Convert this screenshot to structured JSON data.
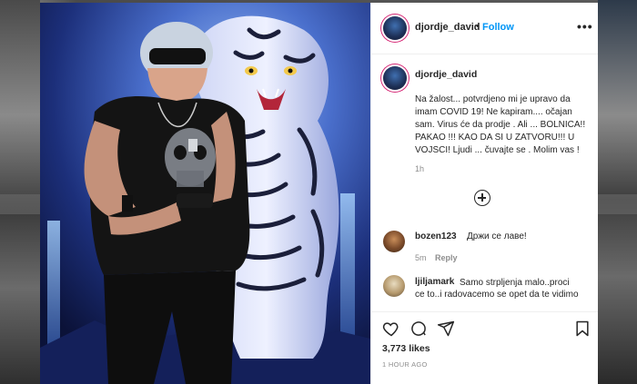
{
  "post": {
    "username": "djordje_david",
    "follow_label": "Follow",
    "separator": "•",
    "more_label": "•••",
    "caption_username": "djordje_david",
    "caption": "Na žalost... potvrdjeno mi je upravo da imam COVID 19! Ne kapiram.... očajan sam. Virus će da prodje . Ali ... BOLNICA!! PAKAO !!! KAO DA SI U ZATVORU!!! U VOJSCI! Ljudi ... čuvajte se . Molim vas !",
    "caption_time": "1h",
    "likes": "3,773 likes",
    "posted_ago": "1 HOUR AGO"
  },
  "comments": [
    {
      "username": "bozen123",
      "text": "Држи се лаве!",
      "time": "5m",
      "reply_label": "Reply"
    },
    {
      "username": "ljiljamark",
      "text": "Samo strpljenja malo..proci ce to..i radovacemo se opet da te vidimo"
    }
  ],
  "icons": {
    "like": "heart-icon",
    "comment": "comment-icon",
    "share": "share-icon",
    "save": "bookmark-icon",
    "load_more": "plus-circle-icon"
  },
  "colors": {
    "follow": "#0095f6",
    "text": "#262626",
    "muted": "#8e8e8e",
    "story_ring": "#d62976"
  }
}
